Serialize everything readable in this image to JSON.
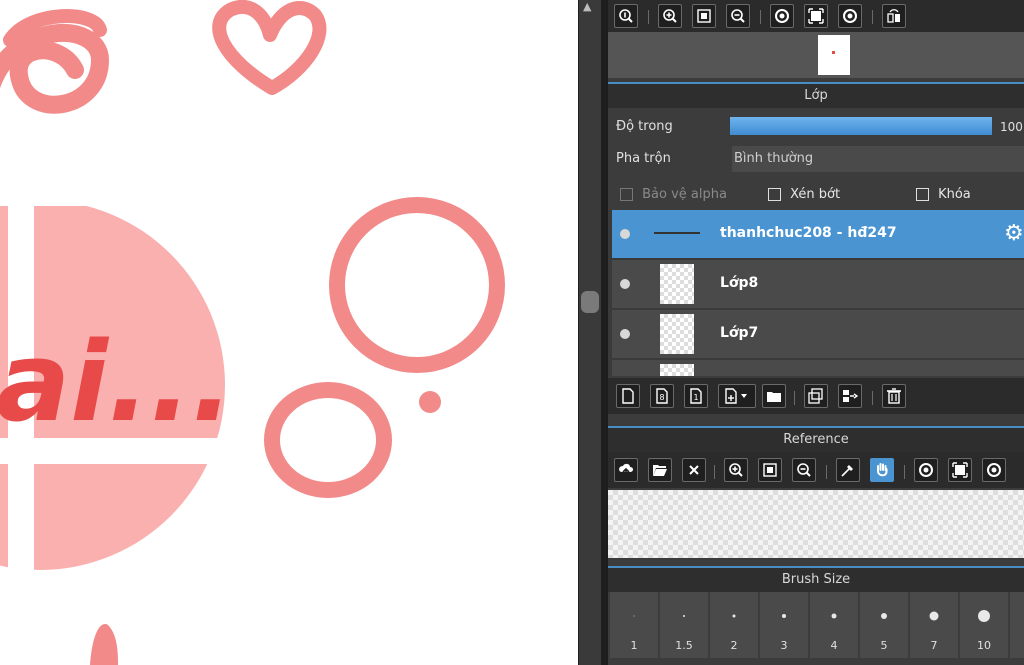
{
  "canvas": {
    "artwork_text": "ai...",
    "colors": {
      "pink": "#f28a8a",
      "light_pink": "#fbb0b0",
      "red": "#e84a4a"
    }
  },
  "navigator": {
    "toolbar_icons": [
      "zoom-fit-icon",
      "zoom-in-icon",
      "fit-screen-icon",
      "zoom-out-icon",
      "rotate-left-icon",
      "fill-screen-icon",
      "rotate-right-icon",
      "flip-icon"
    ]
  },
  "layers": {
    "title": "Lớp",
    "opacity_label": "Độ trong",
    "opacity_value": "100",
    "opacity_fraction": 1.0,
    "blend_label": "Pha trộn",
    "blend_value": "Bình thường",
    "protect_alpha": "Bảo vệ alpha",
    "clip": "Xén bớt",
    "lock": "Khóa",
    "items": [
      {
        "name": "thanhchuc208 - hđ247",
        "active": true
      },
      {
        "name": "Lớp8",
        "active": false
      },
      {
        "name": "Lớp7",
        "active": false
      }
    ],
    "bottom_icons": [
      "new-layer-icon",
      "new-8bit-layer-icon",
      "new-1bit-layer-icon",
      "add-layer-menu-icon",
      "folder-icon",
      "duplicate-icon",
      "merge-icon",
      "delete-icon"
    ]
  },
  "reference": {
    "title": "Reference",
    "toolbar_icons": [
      "upload-icon",
      "open-folder-icon",
      "close-icon",
      "zoom-in-icon",
      "fit-screen-icon",
      "zoom-out-icon",
      "eyedropper-icon",
      "hand-icon",
      "rotate-left-icon",
      "fill-screen-icon",
      "rotate-right-icon"
    ]
  },
  "brush_size": {
    "title": "Brush Size",
    "sizes": [
      "1",
      "1.5",
      "2",
      "3",
      "4",
      "5",
      "7",
      "10"
    ]
  },
  "accent": "#4a95d1"
}
